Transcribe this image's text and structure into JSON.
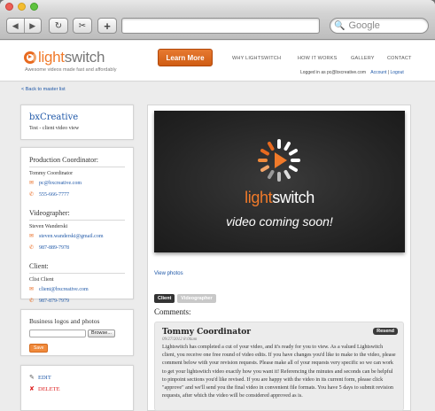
{
  "browser": {
    "back_glyph": "◀",
    "forward_glyph": "▶",
    "reload_glyph": "↻",
    "snapshot_glyph": "✂",
    "plus_glyph": "+",
    "search_placeholder": "Google",
    "search_glyph": "🔍"
  },
  "header": {
    "logo_light": "light",
    "logo_switch": "switch",
    "tagline": "Awesome videos made fast and affordably",
    "learn_more": "Learn More",
    "nav": [
      "WHY LIGHTSWITCH",
      "HOW IT WORKS",
      "GALLERY",
      "CONTACT"
    ],
    "logged_in_text": "Logged in as pc@bxcreative.com",
    "account_link": "Account",
    "separator": "|",
    "logout_link": "Logout",
    "accent_color": "#e86a1f"
  },
  "back_link": "< Back to master list",
  "project": {
    "name": "bxCreative",
    "subtitle": "Test - client video view"
  },
  "contacts": {
    "production": {
      "title": "Production Coordinator:",
      "name": "Tommy Coordinator",
      "email": "pc@bxcreative.com",
      "phone": "555-666-7777"
    },
    "videographer": {
      "title": "Videographer:",
      "name": "Steven Wanderski",
      "email": "steven.wanderski@gmail.com",
      "phone": "987-889-7978"
    },
    "client": {
      "title": "Client:",
      "name": "Clist Client",
      "email": "client@bxcreative.com",
      "phone": "987-879-7979"
    },
    "email_icon": "✉",
    "phone_icon": "✆"
  },
  "logos": {
    "title": "Business logos and photos",
    "browse": "Browse...",
    "save": "Save"
  },
  "actions": {
    "edit": "EDIT",
    "delete": "DELETE",
    "edit_icon": "✎",
    "delete_icon": "✘"
  },
  "video": {
    "brand_light": "light",
    "brand_switch": "switch",
    "coming_soon": "video coming soon!"
  },
  "view_photos": "View photos",
  "tabs": [
    "Client",
    "Videographer"
  ],
  "comments_header": "Comments:",
  "comment": {
    "author": "Tommy Coordinator",
    "date": "09/27/2012 8:06am",
    "resend": "Resend",
    "body": "Lightswitch has completed a cut of your video, and it's ready for you to view. As a valued Lightswitch client, you receive one free round of video edits. If you have changes you'd like to make to the video, please comment below with your revision requests. Please make all of your requests very specific so we can work to get your lightswitch video exactly how you want it! Referencing the minutes and seconds can be helpful to pinpoint sections you'd like revised. If you are happy with the video in its current form, please click \"approve\" and we'll send you the final video in convenient file formats. You have 5 days to submit revision requests, after which the video will be considered approved as is."
  }
}
